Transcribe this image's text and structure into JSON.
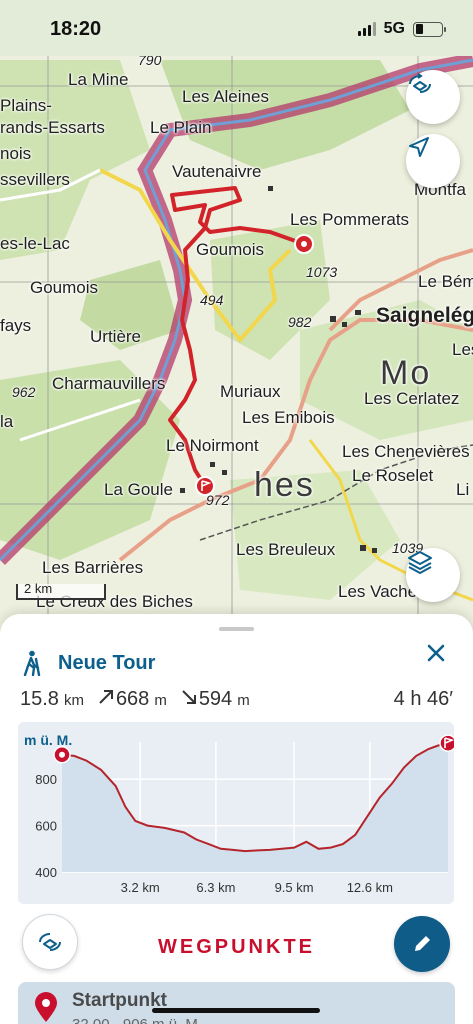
{
  "status_bar": {
    "time": "18:20",
    "network": "5G"
  },
  "map": {
    "labels": {
      "la_mine": "La Mine",
      "les_aleines": "Les Aleines",
      "plains": "Plains-",
      "grands_essarts": "rands-Essarts",
      "le_plain": "Le Plain",
      "nois": "nois",
      "ssevillers": "ssevillers",
      "vautenaivre": "Vautenaivre",
      "montfa": "Montfa",
      "les_pommerats": "Les Pommerats",
      "es_le_lac": "es-le-Lac",
      "goumois_1": "Goumois",
      "goumois_2": "Goumois",
      "alt_1073": "1073",
      "le_bem": "Le Bém",
      "alt_1494": "494",
      "fays": "fays",
      "urtiere": "Urtière",
      "alt_982": "982",
      "saignelegier": "Saignelég",
      "les": "Les",
      "alt_962": "962",
      "charmauvillers": "Charmauvillers",
      "muriaux": "Muriaux",
      "les_cerlatez": "Les Cerlatez",
      "la": "la",
      "les_emibois": "Les Emibois",
      "le_noirmont": "Le Noirmont",
      "les_chenevieres": "Les Chenevières",
      "le_roselet": "Le Roselet",
      "la_goule": "La Goule",
      "alt_972": "972",
      "les_barrieres": "Les Barrières",
      "les_breuleux": "Les Breuleux",
      "alt_1039": "1039",
      "les_vache": "Les Vache",
      "le_creux": "Le Creux des Biches",
      "alt_790": "790",
      "mo": "Mo",
      "hes": "hes",
      "li": "Li"
    },
    "scale": "2 km",
    "icons": {
      "rotate": "rotate-3d-icon",
      "locate": "navigation-arrow-icon",
      "layers": "layers-icon"
    },
    "colors": {
      "route": "#d2232a",
      "river": "#b43a6b"
    }
  },
  "tour": {
    "title": "Neue Tour",
    "distance": "15.8",
    "distance_unit": "km",
    "ascent": "668",
    "ascent_unit": "m",
    "descent": "594",
    "descent_unit": "m",
    "duration": "4 h 46′"
  },
  "profile": {
    "y_unit": "m ü. M.",
    "y_ticks": [
      "800",
      "600",
      "400"
    ],
    "x_ticks": [
      "3.2 km",
      "6.3 km",
      "9.5 km",
      "12.6 km"
    ]
  },
  "chart_data": {
    "type": "area",
    "title": "",
    "xlabel": "",
    "ylabel": "m ü. M.",
    "ylim": [
      400,
      960
    ],
    "xlim": [
      0,
      15.8
    ],
    "x": [
      0,
      0.5,
      1.0,
      1.6,
      2.2,
      2.6,
      3.0,
      3.5,
      4.2,
      5.0,
      5.5,
      6.0,
      6.5,
      7.0,
      7.5,
      8.0,
      8.5,
      9.0,
      9.5,
      10.0,
      10.5,
      11.0,
      11.5,
      12.0,
      12.5,
      13.0,
      13.5,
      14.0,
      14.5,
      15.0,
      15.4,
      15.8
    ],
    "y": [
      905,
      900,
      880,
      840,
      770,
      680,
      620,
      600,
      590,
      570,
      540,
      520,
      500,
      495,
      490,
      493,
      495,
      500,
      505,
      530,
      500,
      505,
      520,
      560,
      640,
      720,
      780,
      850,
      900,
      930,
      945,
      955
    ],
    "grid": true
  },
  "waypoints": {
    "title": "WEGPUNKTE",
    "start_label": "Startpunkt",
    "start_sub": "32.00 · 906 m ü. M."
  }
}
